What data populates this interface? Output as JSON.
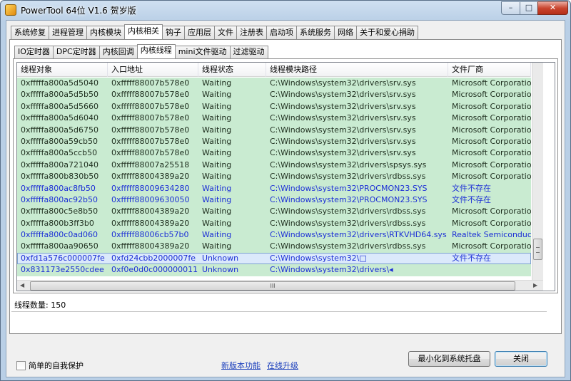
{
  "window": {
    "title": "PowerTool 64位 V1.6 贺岁版",
    "min_label": "–",
    "max_label": "□",
    "close_label": "✕"
  },
  "main_tabs": [
    "系统修复",
    "进程管理",
    "内核模块",
    "内核相关",
    "钩子",
    "应用层",
    "文件",
    "注册表",
    "启动项",
    "系统服务",
    "网络",
    "关于和爱心捐助"
  ],
  "main_active": "内核相关",
  "sub_tabs": [
    "IO定时器",
    "DPC定时器",
    "内核回调",
    "内核线程",
    "mini文件驱动",
    "过滤驱动"
  ],
  "sub_active": "内核线程",
  "table": {
    "columns": [
      "线程对象",
      "入口地址",
      "线程状态",
      "线程模块路径",
      "文件厂商"
    ],
    "rows": [
      {
        "obj": "0xfffffa800a5d5040",
        "entry": "0xfffff88007b578e0",
        "state": "Waiting",
        "path": "C:\\Windows\\system32\\drivers\\srv.sys",
        "vendor": "Microsoft Corporation",
        "style": "normal"
      },
      {
        "obj": "0xfffffa800a5d5b50",
        "entry": "0xfffff88007b578e0",
        "state": "Waiting",
        "path": "C:\\Windows\\system32\\drivers\\srv.sys",
        "vendor": "Microsoft Corporation",
        "style": "normal"
      },
      {
        "obj": "0xfffffa800a5d5660",
        "entry": "0xfffff88007b578e0",
        "state": "Waiting",
        "path": "C:\\Windows\\system32\\drivers\\srv.sys",
        "vendor": "Microsoft Corporation",
        "style": "normal"
      },
      {
        "obj": "0xfffffa800a5d6040",
        "entry": "0xfffff88007b578e0",
        "state": "Waiting",
        "path": "C:\\Windows\\system32\\drivers\\srv.sys",
        "vendor": "Microsoft Corporation",
        "style": "normal"
      },
      {
        "obj": "0xfffffa800a5d6750",
        "entry": "0xfffff88007b578e0",
        "state": "Waiting",
        "path": "C:\\Windows\\system32\\drivers\\srv.sys",
        "vendor": "Microsoft Corporation",
        "style": "normal"
      },
      {
        "obj": "0xfffffa800a59cb50",
        "entry": "0xfffff88007b578e0",
        "state": "Waiting",
        "path": "C:\\Windows\\system32\\drivers\\srv.sys",
        "vendor": "Microsoft Corporation",
        "style": "normal"
      },
      {
        "obj": "0xfffffa800a5ccb50",
        "entry": "0xfffff88007b578e0",
        "state": "Waiting",
        "path": "C:\\Windows\\system32\\drivers\\srv.sys",
        "vendor": "Microsoft Corporation",
        "style": "normal"
      },
      {
        "obj": "0xfffffa800a721040",
        "entry": "0xfffff88007a25518",
        "state": "Waiting",
        "path": "C:\\Windows\\system32\\drivers\\spsys.sys",
        "vendor": "Microsoft Corporation",
        "style": "normal"
      },
      {
        "obj": "0xfffffa800b830b50",
        "entry": "0xfffff88004389a20",
        "state": "Waiting",
        "path": "C:\\Windows\\system32\\drivers\\rdbss.sys",
        "vendor": "Microsoft Corporation",
        "style": "normal"
      },
      {
        "obj": "0xfffffa800ac8fb50",
        "entry": "0xfffff88009634280",
        "state": "Waiting",
        "path": "C:\\Windows\\system32\\PROCMON23.SYS",
        "vendor": "文件不存在",
        "style": "blue"
      },
      {
        "obj": "0xfffffa800ac92b50",
        "entry": "0xfffff88009630050",
        "state": "Waiting",
        "path": "C:\\Windows\\system32\\PROCMON23.SYS",
        "vendor": "文件不存在",
        "style": "blue"
      },
      {
        "obj": "0xfffffa800c5e8b50",
        "entry": "0xfffff88004389a20",
        "state": "Waiting",
        "path": "C:\\Windows\\system32\\drivers\\rdbss.sys",
        "vendor": "Microsoft Corporation",
        "style": "normal"
      },
      {
        "obj": "0xfffffa800b3ff3b0",
        "entry": "0xfffff88004389a20",
        "state": "Waiting",
        "path": "C:\\Windows\\system32\\drivers\\rdbss.sys",
        "vendor": "Microsoft Corporation",
        "style": "normal"
      },
      {
        "obj": "0xfffffa800c0ad060",
        "entry": "0xfffff88006cb57b0",
        "state": "Waiting",
        "path": "C:\\Windows\\system32\\drivers\\RTKVHD64.sys",
        "vendor": "Realtek Semiconduc...",
        "style": "blue"
      },
      {
        "obj": "0xfffffa800aa90650",
        "entry": "0xfffff88004389a20",
        "state": "Waiting",
        "path": "C:\\Windows\\system32\\drivers\\rdbss.sys",
        "vendor": "Microsoft Corporation",
        "style": "normal"
      },
      {
        "obj": "0xfd1a576c000007fe",
        "entry": "0xfd24cbb2000007fe",
        "state": "Unknown",
        "path": "C:\\Windows\\system32\\□",
        "vendor": "文件不存在",
        "style": "selected"
      },
      {
        "obj": "0x831173e2550cdee",
        "entry": "0xf0e0d0c000000011",
        "state": "Unknown",
        "path": "C:\\Windows\\system32\\drivers\\◂",
        "vendor": "",
        "style": "blue"
      }
    ]
  },
  "scroll": {
    "grip": "III"
  },
  "status": {
    "count_label": "线程数量: 150"
  },
  "footer": {
    "self_protect": "简单的自我保护",
    "self_protect_checked": false,
    "link_new_version": "新版本功能",
    "link_online_upgrade": "在线升级",
    "minimize_tray": "最小化到系统托盘",
    "close": "关闭"
  }
}
